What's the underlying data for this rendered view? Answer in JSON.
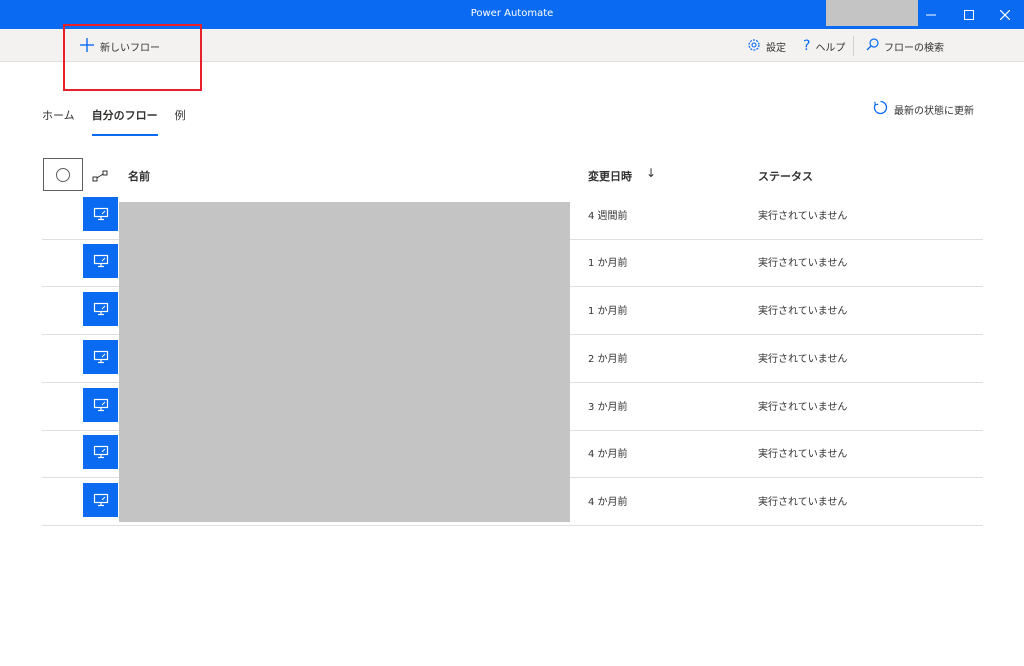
{
  "window": {
    "title": "Power Automate",
    "accent_color": "#0a6bf2",
    "controls": [
      "minimize-icon",
      "maximize-icon",
      "close-icon"
    ]
  },
  "toolbar": {
    "new_flow_label": "新しいフロー",
    "settings_label": "設定",
    "help_label": "ヘルプ",
    "search_label": "フローの検索"
  },
  "tabs": [
    {
      "label": "ホーム",
      "active": false
    },
    {
      "label": "自分のフロー",
      "active": true
    },
    {
      "label": "例",
      "active": false
    }
  ],
  "refresh_label": "最新の状態に更新",
  "table": {
    "columns": {
      "name": "名前",
      "modified": "変更日時",
      "status": "ステータス"
    },
    "sort_arrow": "↓",
    "rows": [
      {
        "modified": "4 週間前",
        "status": "実行されていません"
      },
      {
        "modified": "1 か月前",
        "status": "実行されていません"
      },
      {
        "modified": "1 か月前",
        "status": "実行されていません"
      },
      {
        "modified": "2 か月前",
        "status": "実行されていません"
      },
      {
        "modified": "3 か月前",
        "status": "実行されていません"
      },
      {
        "modified": "4 か月前",
        "status": "実行されていません"
      },
      {
        "modified": "4 か月前",
        "status": "実行されていません"
      }
    ]
  }
}
